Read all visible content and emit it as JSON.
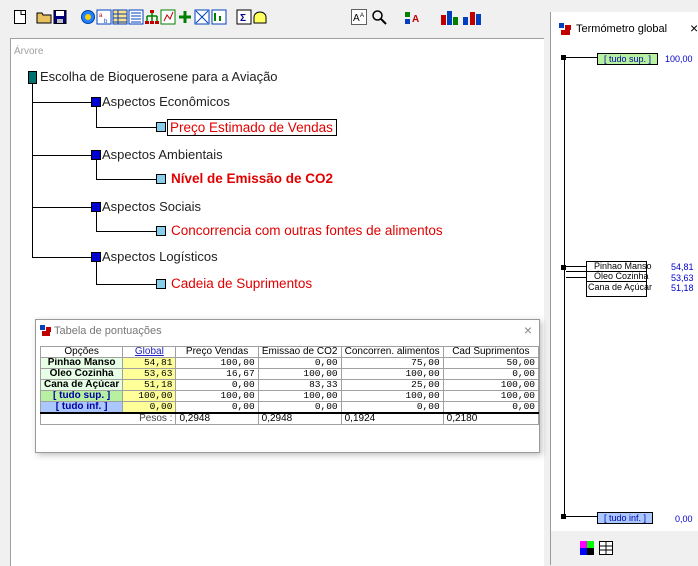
{
  "toolbar": {
    "icons": [
      "new-document-icon",
      "open-folder-icon",
      "save-icon",
      "analyze-icon",
      "sort-icon",
      "table-icon",
      "list-icon",
      "tree-structure-icon",
      "data-icon",
      "add-icon",
      "graph-icon",
      "chart-icon",
      "calculator-icon",
      "lightbulb-icon",
      "font-size-icon",
      "search-icon",
      "add-node-icon",
      "bar-chart-icon",
      "scores-icon"
    ]
  },
  "tree": {
    "panel_title": "Árvore",
    "root": {
      "label": "Escolha de Bioquerosene para a Aviação",
      "color": "#007070"
    },
    "aspects": [
      {
        "label": "Aspectos Econômicos",
        "criterion": "Preço Estimado de Vendas"
      },
      {
        "label": "Aspectos Ambientais",
        "criterion": "Nível de Emissão de CO2"
      },
      {
        "label": "Aspectos Sociais",
        "criterion": "Concorrencia com outras fontes de alimentos"
      },
      {
        "label": "Aspectos Logísticos",
        "criterion": "Cadeia de Suprimentos"
      }
    ],
    "aspect_color": "#0000d0",
    "criterion_box_color": "#87ceeb",
    "criterion_text_color": "#e00000"
  },
  "scores_table": {
    "title": "Tabela de pontuações",
    "close": "×",
    "columns": [
      "Opções",
      "Global",
      "Preço Vendas",
      "Emissao de CO2",
      "Concorren. alimentos",
      "Cad Suprimentos"
    ],
    "rows": [
      {
        "option": "Pinhao Manso",
        "global": "54,81",
        "values": [
          "100,00",
          "0,00",
          "75,00",
          "50,00"
        ]
      },
      {
        "option": "Óleo Cozinha",
        "global": "53,63",
        "values": [
          "16,67",
          "100,00",
          "100,00",
          "0,00"
        ]
      },
      {
        "option": "Cana de Açúcar",
        "global": "51,18",
        "values": [
          "0,00",
          "83,33",
          "25,00",
          "100,00"
        ]
      },
      {
        "option": "[ tudo sup. ]",
        "global": "100,00",
        "values": [
          "100,00",
          "100,00",
          "100,00",
          "100,00"
        ]
      },
      {
        "option": "[ tudo inf. ]",
        "global": "0,00",
        "values": [
          "0,00",
          "0,00",
          "0,00",
          "0,00"
        ]
      }
    ],
    "weights_label": "Pesos :",
    "weights": [
      "0,2948",
      "0,2948",
      "0,1924",
      "0,2180"
    ],
    "colors": {
      "option_bg": "#e6ffe6",
      "global_bg": "#ffff99",
      "sup_bg": "#b6f0a0",
      "inf_bg": "#aac8ff"
    }
  },
  "thermometer": {
    "title": "Termómetro global",
    "close": "×",
    "top": {
      "label": "[ tudo sup. ]",
      "value": "100,00"
    },
    "options": [
      {
        "label": "Pinhao Manso",
        "value": "54,81"
      },
      {
        "label": "Óleo Cozinha",
        "value": "53,63"
      },
      {
        "label": "Cana de Açúcar",
        "value": "51,18"
      }
    ],
    "bottom": {
      "label": "[ tudo inf. ]",
      "value": "0,00"
    },
    "bottom_icons": [
      "color-palette-icon",
      "grid-icon"
    ]
  }
}
